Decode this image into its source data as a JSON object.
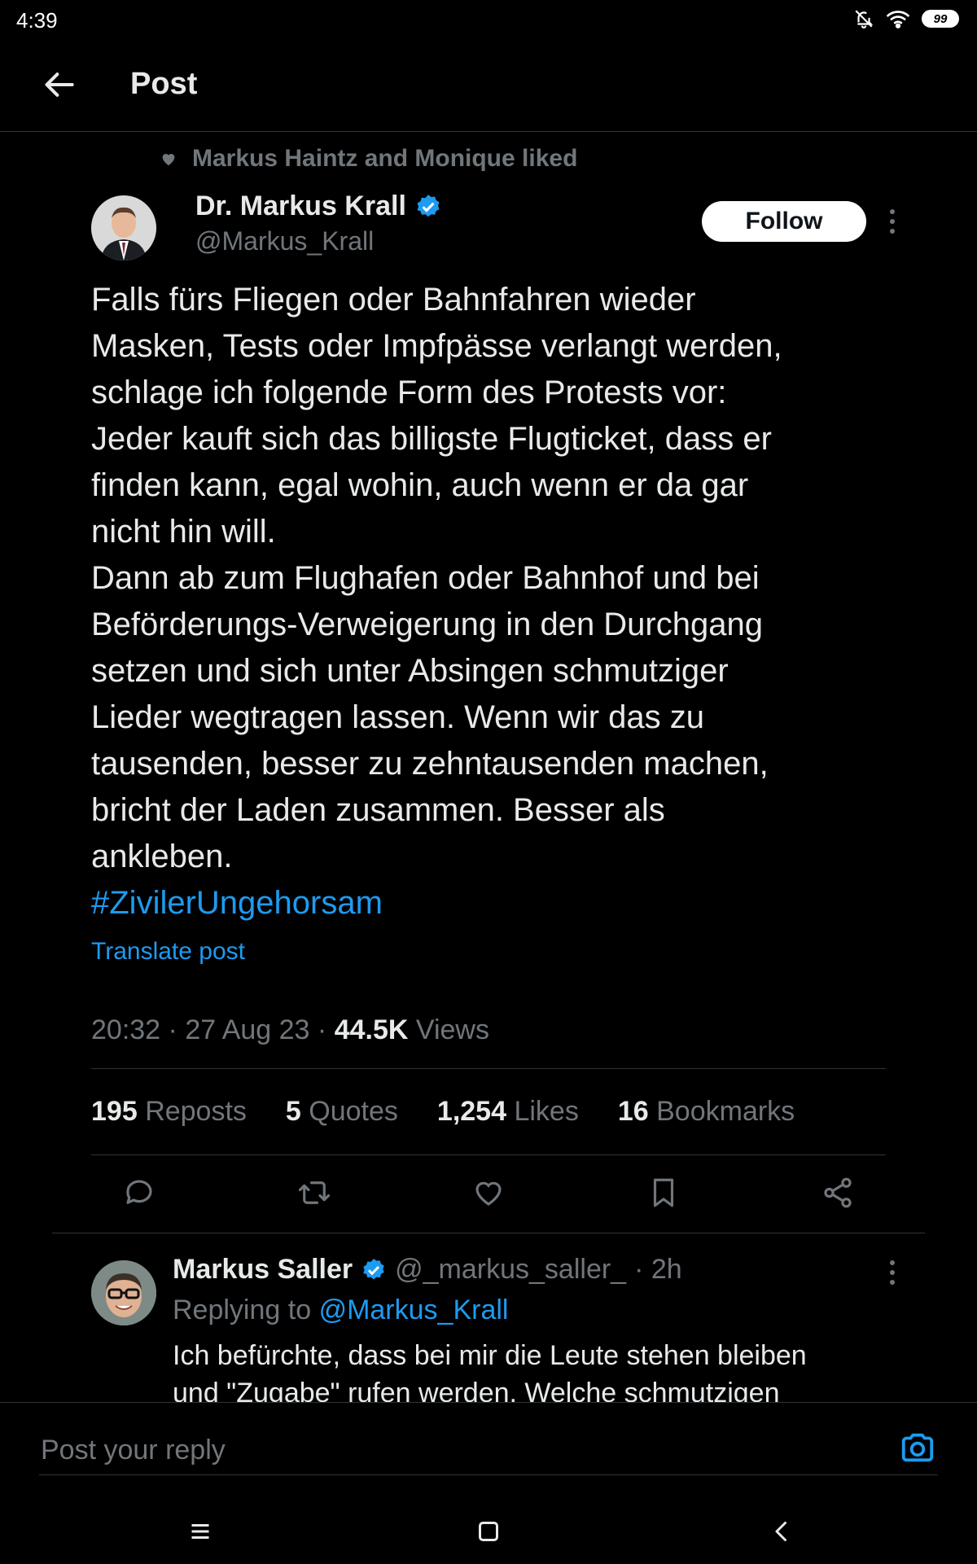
{
  "status": {
    "time": "4:39",
    "battery": "99"
  },
  "header": {
    "title": "Post"
  },
  "social_context": {
    "text": "Markus Haintz and Monique liked"
  },
  "author": {
    "name": "Dr. Markus Krall",
    "handle": "@Markus_Krall"
  },
  "follow_button": {
    "label": "Follow"
  },
  "post": {
    "body": "Falls fürs Fliegen oder Bahnfahren wieder\nMasken, Tests oder Impfpässe verlangt werden,\nschlage ich folgende Form des Protests vor:\nJeder kauft sich das billigste Flugticket, dass er\nfinden kann, egal wohin, auch wenn er da gar\nnicht hin will.\nDann ab zum Flughafen oder Bahnhof und bei\nBeförderungs-Verweigerung in den Durchgang\nsetzen und sich unter Absingen schmutziger\nLieder wegtragen lassen. Wenn wir das zu\ntausenden, besser zu zehntausenden machen,\nbricht der Laden zusammen. Besser als\nankleben.\n",
    "hashtag": "#ZivilerUngehorsam",
    "translate_label": "Translate post",
    "time": "20:32",
    "date": "27 Aug 23",
    "views_count": "44.5K",
    "views_label": "Views"
  },
  "stats": {
    "reposts_count": "195",
    "reposts_label": "Reposts",
    "quotes_count": "5",
    "quotes_label": "Quotes",
    "likes_count": "1,254",
    "likes_label": "Likes",
    "bookmarks_count": "16",
    "bookmarks_label": "Bookmarks"
  },
  "actions": [
    "reply-icon",
    "repost-icon",
    "like-icon",
    "bookmark-icon",
    "share-icon"
  ],
  "reply": {
    "name": "Markus Saller",
    "handle": "@_markus_saller_",
    "time": "· 2h",
    "replying_prefix": "Replying to",
    "replying_to": "@Markus_Krall",
    "text": "Ich befürchte, dass bei mir die Leute stehen bleiben\nund \"Zugabe\" rufen werden. Welche schmutzigen"
  },
  "composer": {
    "placeholder": "Post your reply"
  },
  "colors": {
    "accent": "#1d9bf0",
    "background": "#000000",
    "muted": "#71767b",
    "text": "#e7e9ea"
  }
}
